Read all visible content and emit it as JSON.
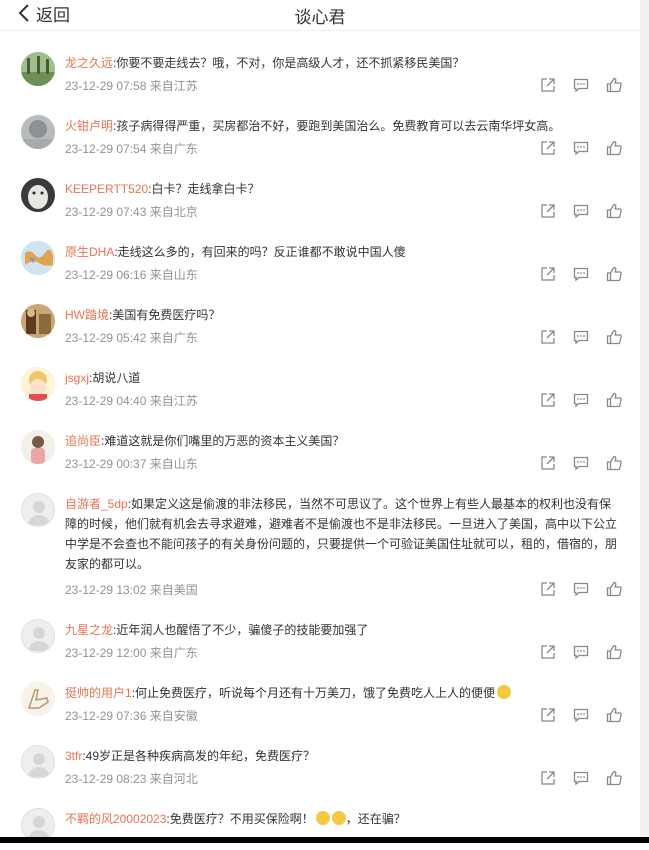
{
  "header": {
    "back_label": "返回",
    "title": "谈心君"
  },
  "comments": [
    {
      "user": "龙之久远",
      "text": ":你要不要走线去？哦，不对，你是高级人才，还不抓紧移民美国？",
      "meta": "23-12-29 07:58 来自江苏"
    },
    {
      "user": "火钳卢明",
      "text": ":孩子病得得严重，买房都治不好，要跑到美国治么。免费教育可以去云南华坪女高。",
      "meta": "23-12-29 07:54 来自广东"
    },
    {
      "user": "KEEPERTT520",
      "text": ":白卡？走线拿白卡？",
      "meta": "23-12-29 07:43 来自北京"
    },
    {
      "user": "原生DHA",
      "text": ":走线这么多的，有回来的吗？反正谁都不敢说中国人傻",
      "meta": "23-12-29 06:16 来自山东"
    },
    {
      "user": "HW踏境",
      "text": ":美国有免费医疗吗？",
      "meta": "23-12-29 05:42 来自广东"
    },
    {
      "user": "jsgxj",
      "text": ":胡说八道",
      "meta": "23-12-29 04:40 来自江苏"
    },
    {
      "user": "追尚臣",
      "text": ":难道这就是你们嘴里的万恶的资本主义美国？",
      "meta": "23-12-29 00:37 来自山东"
    },
    {
      "user": "自游者_5dp",
      "text": ":如果定义这是偷渡的非法移民，当然不可思议了。这个世界上有些人最基本的权利也没有保障的时候，他们就有机会去寻求避难，避难者不是偷渡也不是非法移民。一旦进入了美国，高中以下公立中学是不会查也不能问孩子的有关身份问题的，只要提供一个可验证美国住址就可以，租的，借宿的，朋友家的都可以。",
      "meta": "23-12-29 13:02 来自美国"
    },
    {
      "user": "九星之龙",
      "text": ":近年润人也醒悟了不少，骗傻子的技能要加强了",
      "meta": "23-12-29 12:00 来自广东"
    },
    {
      "user": "挺帅的用户1",
      "text": ":何止免费医疗，听说每个月还有十万美刀，饿了免费吃人上人的便便",
      "meta": "23-12-29 07:36 来自安徽"
    },
    {
      "user": "3tfr",
      "text": ":49岁正是各种疾病高发的年纪，免费医疗？",
      "meta": "23-12-29 08:23 来自河北"
    },
    {
      "user": "不羁的风20002023",
      "text": ":免费医疗？不用买保险啊！",
      "text2": "，还在骗？",
      "meta": ""
    }
  ]
}
